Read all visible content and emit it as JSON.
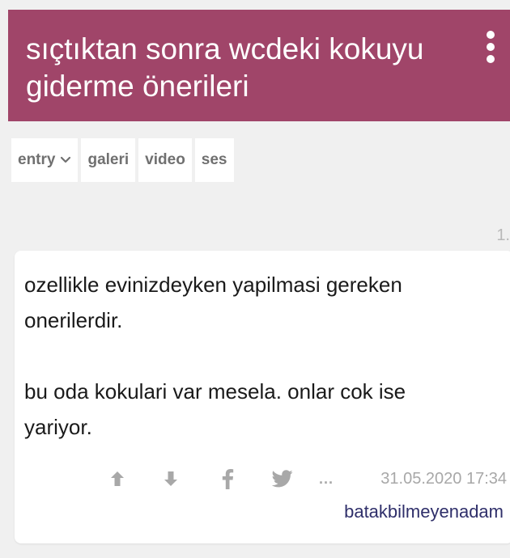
{
  "topic": {
    "title": "sıçtıktan sonra wcdeki kokuyu giderme önerileri",
    "menu_icon": "vertical-ellipsis-icon"
  },
  "tabs": [
    {
      "label": "entry",
      "icon": "chevron-down-icon"
    },
    {
      "label": "galeri"
    },
    {
      "label": "video"
    },
    {
      "label": "ses"
    }
  ],
  "entry": {
    "number": "1.",
    "paragraphs": [
      "ozellikle evinizdeyken yapilmasi gereken onerilerdir.",
      "bu oda kokulari var mesela. onlar cok ise yariyor."
    ],
    "more": "...",
    "date": "31.05.2020 17:34",
    "author": "batakbilmeyenadam"
  },
  "colors": {
    "header_bg": "#a04569",
    "background": "#f0f0f0",
    "icon_gray": "#a8a8a8",
    "author": "#2f2f6a"
  }
}
